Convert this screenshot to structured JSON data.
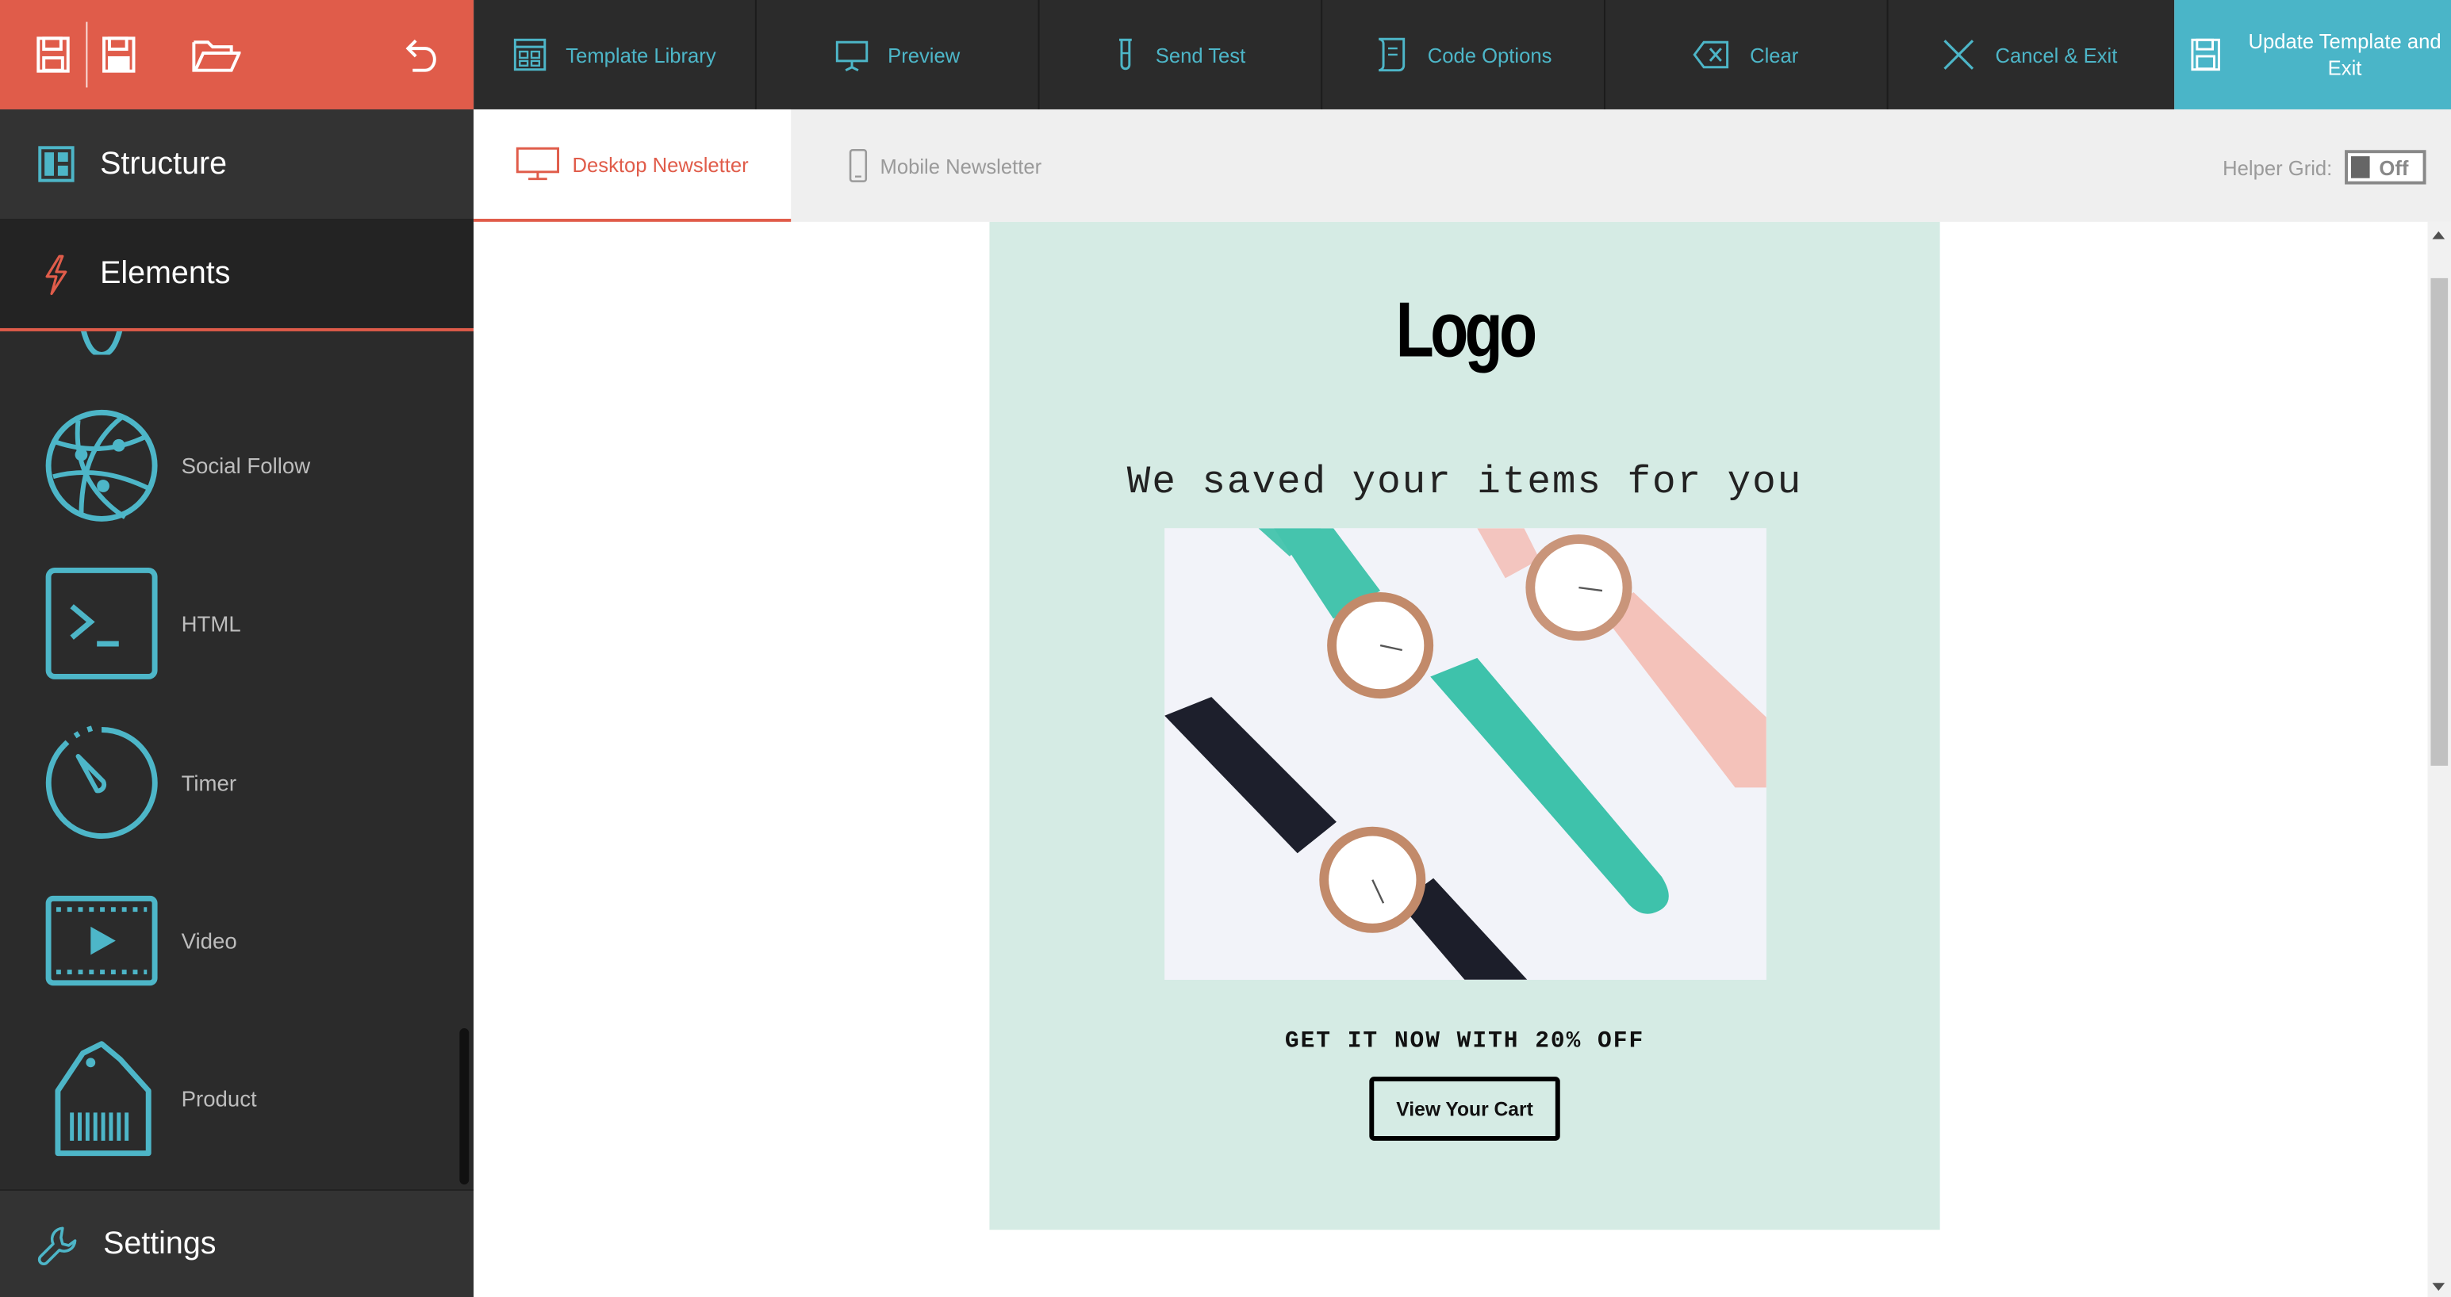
{
  "toolbar": {
    "buttons": [
      {
        "label": "Template Library",
        "icon": "template-library-icon"
      },
      {
        "label": "Preview",
        "icon": "preview-icon"
      },
      {
        "label": "Send Test",
        "icon": "send-test-icon"
      },
      {
        "label": "Code Options",
        "icon": "code-options-icon"
      },
      {
        "label": "Clear",
        "icon": "clear-icon"
      },
      {
        "label": "Cancel & Exit",
        "icon": "close-icon"
      }
    ],
    "update_label": "Update Template and Exit",
    "left_icons": [
      "save-icon",
      "save-as-icon",
      "open-folder-icon",
      "undo-icon"
    ]
  },
  "sidebar": {
    "structure_label": "Structure",
    "elements_label": "Elements",
    "settings_label": "Settings",
    "elements": [
      {
        "label": "Social Follow",
        "icon": "globe-network-icon"
      },
      {
        "label": "HTML",
        "icon": "terminal-icon"
      },
      {
        "label": "Timer",
        "icon": "timer-icon"
      },
      {
        "label": "Video",
        "icon": "video-icon"
      },
      {
        "label": "Product",
        "icon": "product-tag-icon"
      }
    ]
  },
  "tabs": {
    "desktop_label": "Desktop Newsletter",
    "mobile_label": "Mobile Newsletter",
    "helper_label": "Helper Grid:",
    "helper_value": "Off"
  },
  "email": {
    "logo": "Logo",
    "headline": "We saved your items for you",
    "offer": "GET IT NOW WITH 20% OFF",
    "cta": "View Your Cart"
  },
  "colors": {
    "accent": "#e05c4a",
    "teal": "#4db6c8",
    "dark": "#2b2b2b",
    "email_bg": "#d5ebe4"
  }
}
